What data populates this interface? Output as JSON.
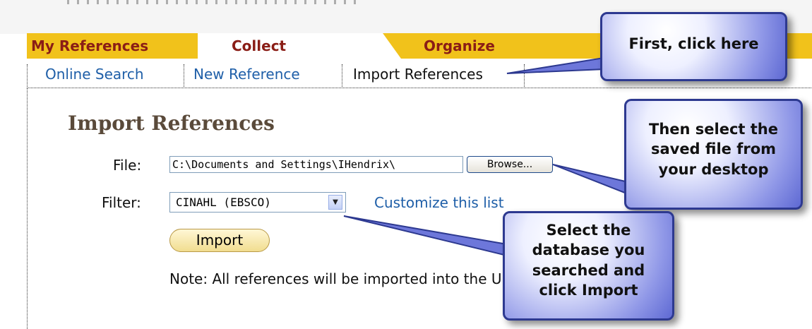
{
  "tabs": {
    "my_references": "My References",
    "collect": "Collect",
    "organize": "Organize"
  },
  "subnav": {
    "online_search": "Online Search",
    "new_reference": "New Reference",
    "import_references": "Import References"
  },
  "form": {
    "title": "Import References",
    "file_label": "File:",
    "file_value": "C:\\Documents and Settings\\IHendrix\\",
    "browse_label": "Browse...",
    "filter_label": "Filter:",
    "filter_value": "CINAHL (EBSCO)",
    "customize_link": "Customize this list",
    "import_label": "Import",
    "note": "Note: All references will be imported into the Unfiled group."
  },
  "callouts": {
    "first": "First, click here",
    "second_lines": [
      "Then select the",
      "saved file from",
      "your desktop"
    ],
    "third_lines": [
      "Select the",
      "database you",
      "searched and",
      "click Import"
    ]
  },
  "colors": {
    "tab_bar": "#f1c21b",
    "tab_text": "#8a1d16",
    "link": "#1f5fa8",
    "callout_border": "#2d3990"
  }
}
